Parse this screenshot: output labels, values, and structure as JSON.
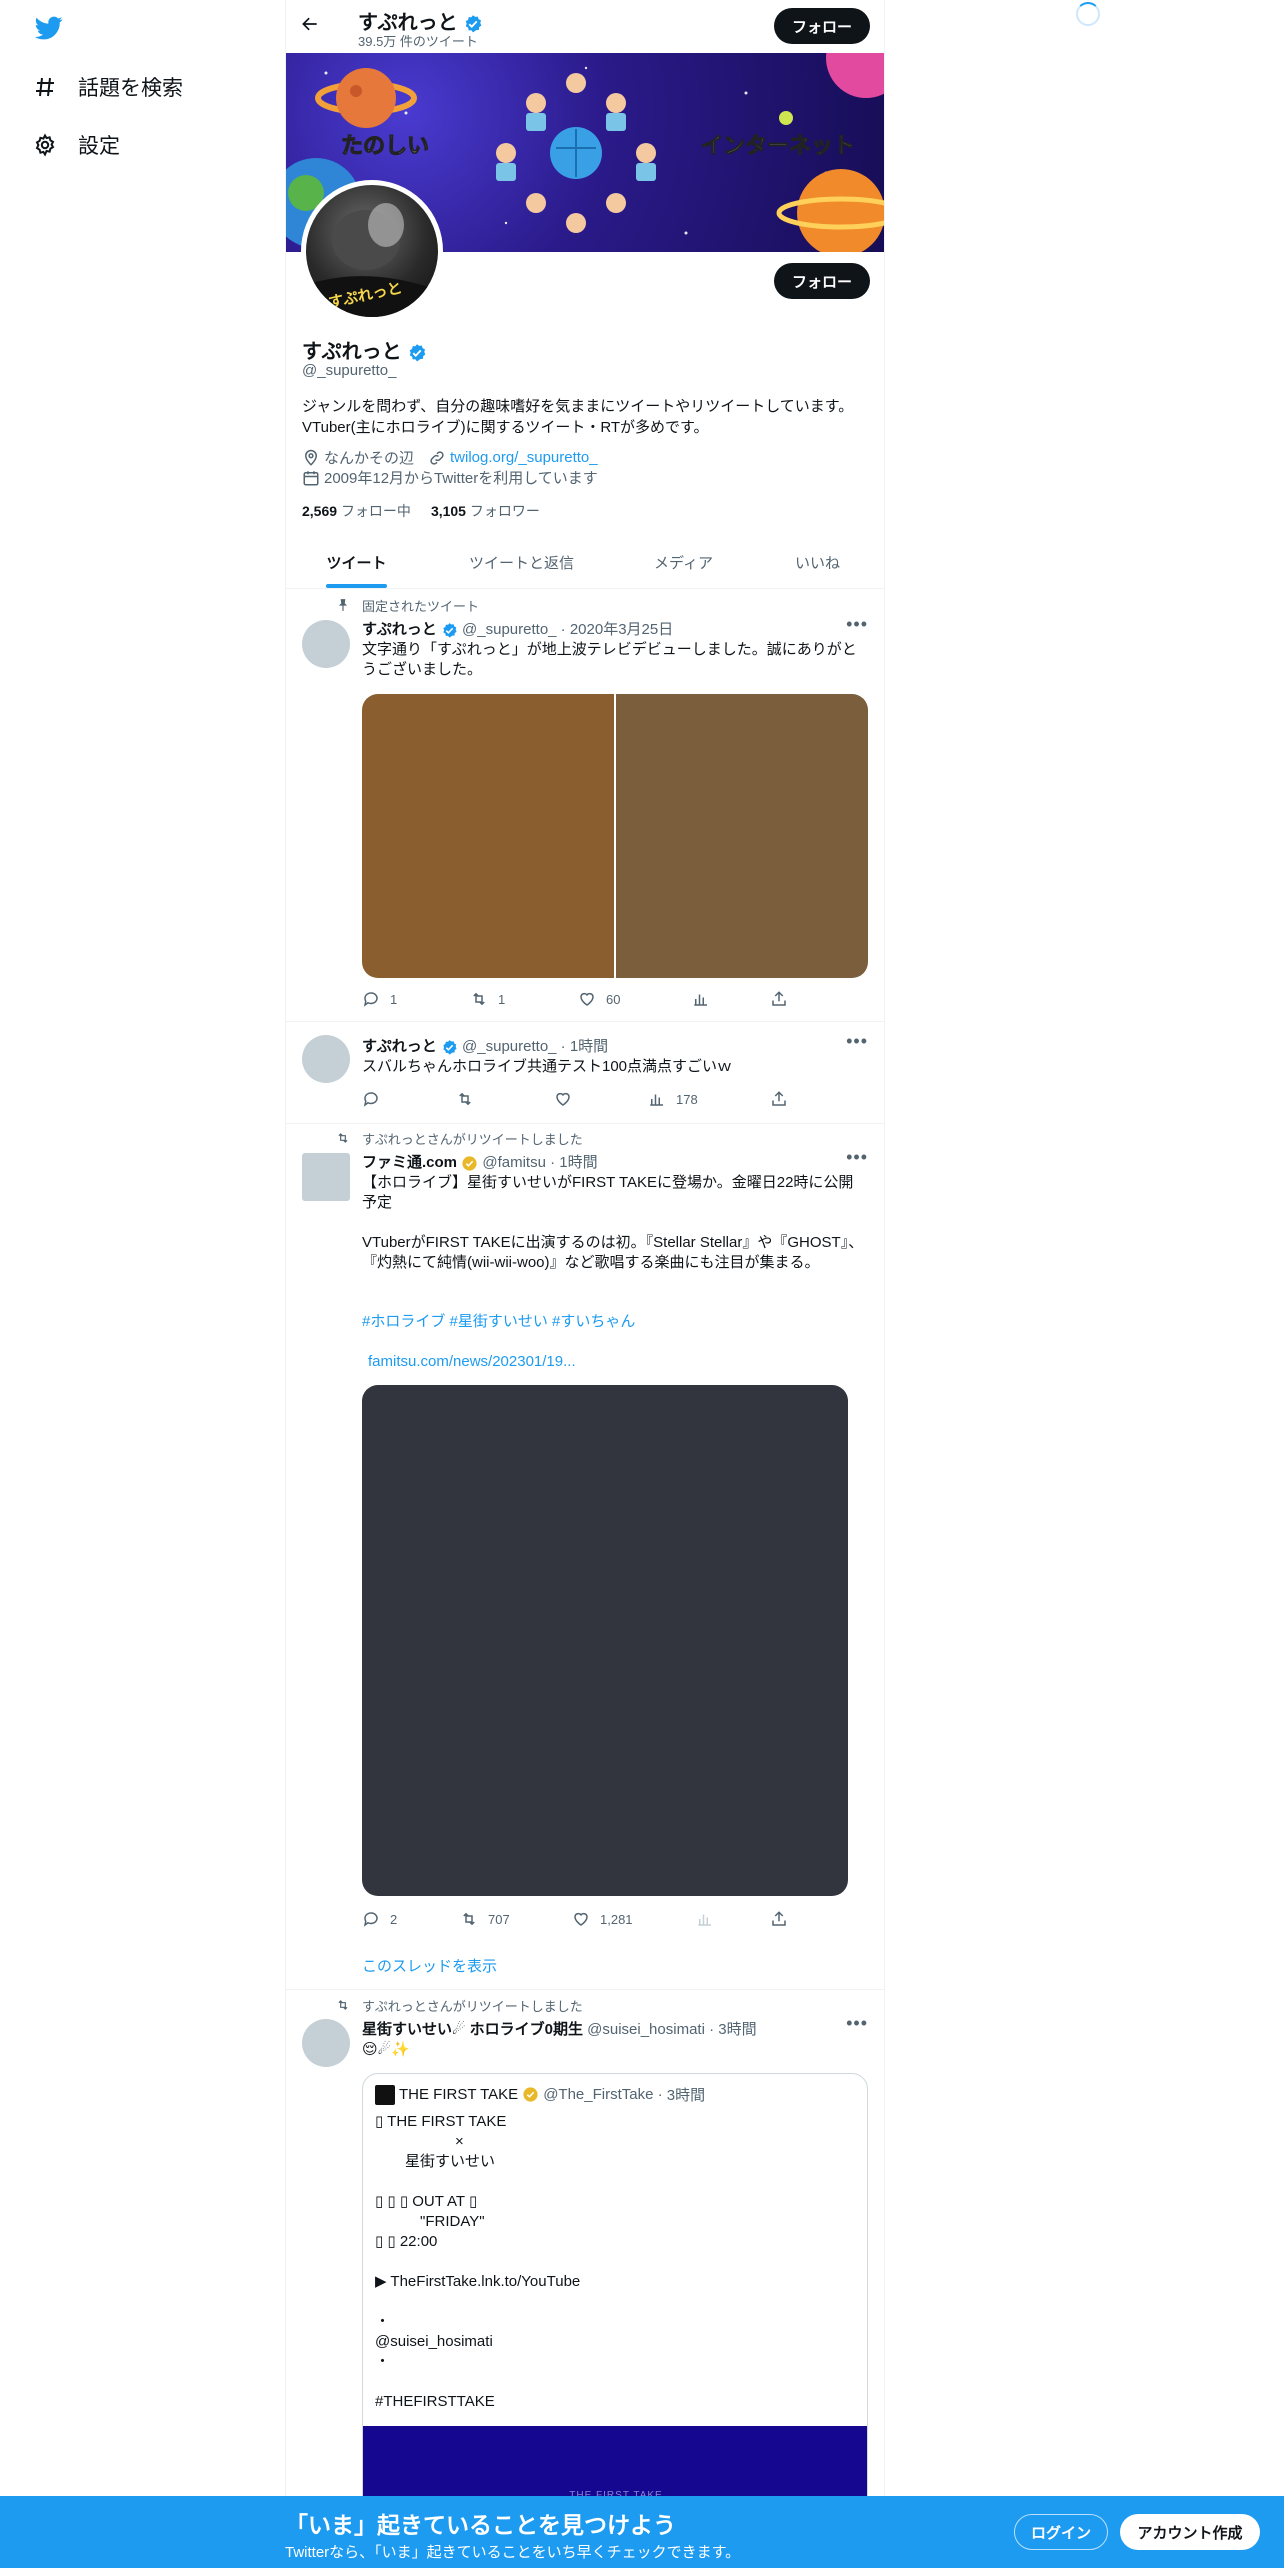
{
  "nav": {
    "explore_label": "話題を検索",
    "settings_label": "設定"
  },
  "header": {
    "name": "すぷれっと",
    "tweet_count": "39.5万 件のツイート",
    "follow_label": "フォロー"
  },
  "banner": {
    "left_text": "たのしい",
    "right_text": "インターネット"
  },
  "avatar": {
    "text": "すぷれっと"
  },
  "profile": {
    "name": "すぷれっと",
    "handle": "@_supuretto_",
    "follow_label": "フォロー",
    "bio_line1": "ジャンルを問わず、自分の趣味嗜好を気ままにツイートやリツイートしています。",
    "bio_line2": "VTuber(主にホロライブ)に関するツイート・RTが多めです。",
    "location": "なんかその辺",
    "website": "twilog.org/_supuretto_",
    "joined": "2009年12月からTwitterを利用しています",
    "following_count": "2,569",
    "following_label": "フォロー中",
    "followers_count": "3,105",
    "followers_label": "フォロワー"
  },
  "tabs": [
    "ツイート",
    "ツイートと返信",
    "メディア",
    "いいね"
  ],
  "tweets": [
    {
      "context": "固定されたツイート",
      "name": "すぷれっと",
      "handle": "@_supuretto_",
      "time": "2020年3月25日",
      "text": "文字通り「すぷれっと」が地上波テレビデビューしました。誠にありがとうございました。",
      "replies": "1",
      "retweets": "1",
      "likes": "60",
      "views": ""
    },
    {
      "name": "すぷれっと",
      "handle": "@_supuretto_",
      "time": "1時間",
      "text": "スバルちゃんホロライブ共通テスト100点満点すごいｗ",
      "replies": "",
      "retweets": "",
      "likes": "",
      "views": "178"
    },
    {
      "context": "すぷれっとさんがリツイートしました",
      "name": "ファミ通.com",
      "handle": "@famitsu",
      "time": "1時間",
      "text_line1": "【ホロライブ】星街すいせいがFIRST TAKEに登場か。金曜日22時に公開予定",
      "text_body": "VTuberがFIRST TAKEに出演するのは初。『Stellar Stellar』や『GHOST』、『灼熱にて純情(wii-wii-woo)』など歌唱する楽曲にも注目が集まる。",
      "hashtags": "#ホロライブ #星街すいせい #すいちゃん",
      "link": "famitsu.com/news/202301/19...",
      "replies": "2",
      "retweets": "707",
      "likes": "1,281",
      "show_thread": "このスレッドを表示"
    },
    {
      "context": "すぷれっとさんがリツイートしました",
      "name": "星街すいせい☄ ホロライブ0期生",
      "handle": "@suisei_hosimati",
      "time": "3時間",
      "text": "😌☄✨",
      "quote": {
        "name": "THE FIRST TAKE",
        "handle": "@The_FirstTake",
        "time": "3時間",
        "line1": "▯ THE FIRST TAKE",
        "line2": "×",
        "line3": "星街すいせい",
        "line4": "▯ ▯ ▯ OUT AT ▯",
        "line5": "\"FRIDAY\"",
        "line6": "▯ ▯ 22:00",
        "line7": "▶ TheFirstTake.lnk.to/YouTube",
        "line8": "・",
        "line9": "@suisei_hosimati",
        "line10": "・",
        "line11": "#THEFIRSTTAKE",
        "media_caption": "THE FIRST TAKE"
      }
    }
  ],
  "bottom": {
    "title": "「いま」起きていることを見つけよう",
    "subtitle": "Twitterなら、「いま」起きていることをいち早くチェックできます。",
    "login": "ログイン",
    "signup": "アカウント作成"
  },
  "colors": {
    "accent": "#1d9bf0",
    "text": "#0f1419",
    "muted": "#536471",
    "bottom_bar": "#1d9bf0"
  }
}
